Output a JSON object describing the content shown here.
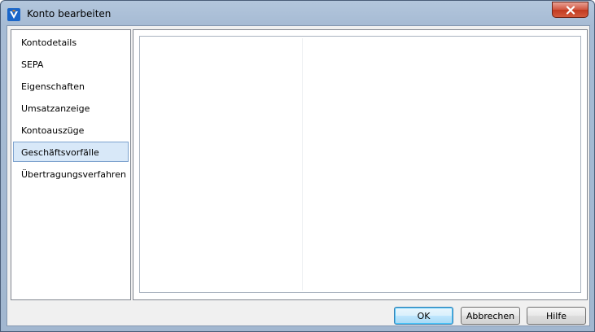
{
  "window": {
    "title": "Konto bearbeiten",
    "app_icon": "volksbank-v-icon"
  },
  "nav": {
    "items": [
      {
        "label": "Kontodetails",
        "selected": false
      },
      {
        "label": "SEPA",
        "selected": false
      },
      {
        "label": "Eigenschaften",
        "selected": false
      },
      {
        "label": "Umsatzanzeige",
        "selected": false
      },
      {
        "label": "Kontoauszüge",
        "selected": false
      },
      {
        "label": "Geschäftsvorfälle",
        "selected": true
      },
      {
        "label": "Übertragungsverfahren",
        "selected": false
      }
    ]
  },
  "buttons": {
    "ok": "OK",
    "cancel": "Abbrechen",
    "help": "Hilfe"
  },
  "colors": {
    "selection_bg": "#d8e8f8",
    "selection_border": "#7da2ce",
    "close_button": "#c13a20"
  }
}
